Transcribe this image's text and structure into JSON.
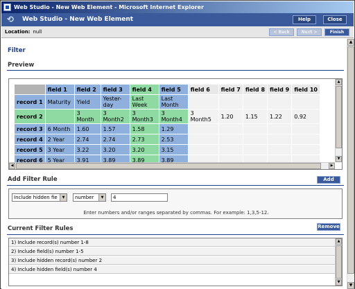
{
  "window": {
    "title": "Web Studio - New Web Element - Microsoft Internet Explorer"
  },
  "header": {
    "title": "Web Studio - New Web Element",
    "help_label": "Help",
    "close_label": "Close"
  },
  "location": {
    "label": "Location:",
    "value": "null",
    "back_label": "< Back",
    "next_label": "Next >",
    "finish_label": "Finish"
  },
  "filter": {
    "title": "Filter"
  },
  "preview": {
    "title": "Preview",
    "columns": [
      "field 1",
      "field 2",
      "field 3",
      "field 4",
      "field 5",
      "field 6",
      "field 7",
      "field 8",
      "field 9",
      "field 10"
    ],
    "rows": [
      {
        "label": "record 1",
        "cells": [
          "Maturity",
          "Yield",
          "Yester-day",
          "Last Week",
          "Last Month",
          "",
          "",
          "",
          "",
          ""
        ]
      },
      {
        "label": "record 2",
        "cells": [
          "",
          "3 Month",
          "3 Month2",
          "3 Month3",
          "3 Month4",
          "3 Month5",
          "1.20",
          "1.15",
          "1.22",
          "0.92"
        ]
      },
      {
        "label": "record 3",
        "cells": [
          "6 Month",
          "1.60",
          "1.57",
          "1.58",
          "1.29",
          "",
          "",
          "",
          "",
          ""
        ]
      },
      {
        "label": "record 4",
        "cells": [
          "2 Year",
          "2.74",
          "2.74",
          "2.73",
          "2.53",
          "",
          "",
          "",
          "",
          ""
        ]
      },
      {
        "label": "record 5",
        "cells": [
          "3 Year",
          "3.22",
          "3.20",
          "3.20",
          "3.15",
          "",
          "",
          "",
          "",
          ""
        ]
      },
      {
        "label": "record 6",
        "cells": [
          "5 Year",
          "3.91",
          "3.89",
          "3.89",
          "3.89",
          "",
          "",
          "",
          "",
          ""
        ]
      }
    ]
  },
  "add_rule": {
    "title": "Add Filter Rule",
    "add_label": "Add",
    "type_select": "Include hidden fie",
    "mode_select": "number",
    "value": "4",
    "hint": "Enter numbers and/or ranges separated by commas. For example: 1,3,5-12."
  },
  "current_rules": {
    "title": "Current Filter Rules",
    "remove_label": "Remove",
    "items": [
      "1) Include record(s) number 1-8",
      "2) Include field(s) number 1-5",
      "3) Include hidden record(s) number 2",
      "4) Include hidden field(s) number 4"
    ]
  },
  "colors": {
    "accent": "#3a5a9c",
    "blue_cell": "#8fb0dc",
    "green_cell": "#8fd9a3"
  }
}
